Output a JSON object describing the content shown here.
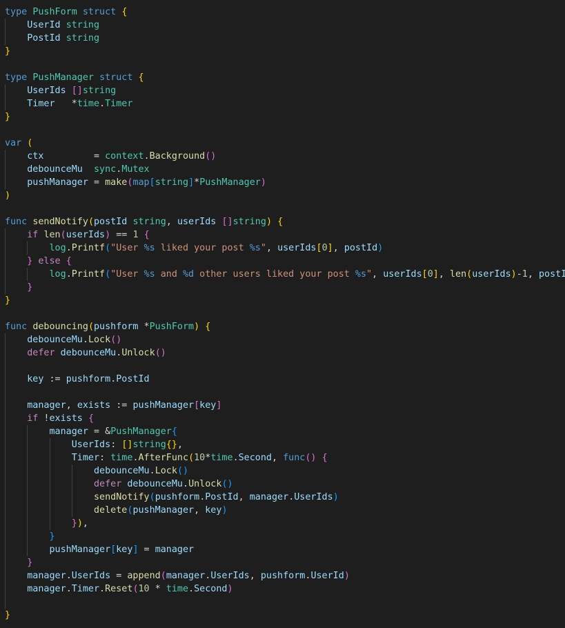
{
  "colors": {
    "background": "#1e1e1e",
    "keyword": "#569cd6",
    "control": "#c586c0",
    "type": "#4ec9b0",
    "variable": "#9cdcfe",
    "function": "#dcdcaa",
    "string": "#ce9178",
    "number": "#b5cea8",
    "bracket_level_1": "#ffd700",
    "bracket_level_2": "#da70d6",
    "bracket_level_3": "#179fff",
    "plain": "#d4d4d4"
  },
  "code": {
    "lines": [
      {
        "indent": 0,
        "tokens": [
          [
            "type",
            "kw"
          ],
          [
            " ",
            "op"
          ],
          [
            "PushForm",
            "type"
          ],
          [
            " ",
            "op"
          ],
          [
            "struct",
            "kw"
          ],
          [
            " ",
            "op"
          ],
          [
            "{",
            "b1"
          ]
        ]
      },
      {
        "indent": 1,
        "tokens": [
          [
            "UserId",
            "var"
          ],
          [
            " ",
            "op"
          ],
          [
            "string",
            "type"
          ]
        ]
      },
      {
        "indent": 1,
        "tokens": [
          [
            "PostId",
            "var"
          ],
          [
            " ",
            "op"
          ],
          [
            "string",
            "type"
          ]
        ]
      },
      {
        "indent": 0,
        "tokens": [
          [
            "}",
            "b1"
          ]
        ]
      },
      {
        "indent": 0,
        "tokens": []
      },
      {
        "indent": 0,
        "tokens": [
          [
            "type",
            "kw"
          ],
          [
            " ",
            "op"
          ],
          [
            "PushManager",
            "type"
          ],
          [
            " ",
            "op"
          ],
          [
            "struct",
            "kw"
          ],
          [
            " ",
            "op"
          ],
          [
            "{",
            "b1"
          ]
        ]
      },
      {
        "indent": 1,
        "tokens": [
          [
            "UserIds",
            "var"
          ],
          [
            " ",
            "op"
          ],
          [
            "[]",
            "b2"
          ],
          [
            "string",
            "type"
          ]
        ]
      },
      {
        "indent": 1,
        "tokens": [
          [
            "Timer",
            "var"
          ],
          [
            "   *",
            "op"
          ],
          [
            "time",
            "type"
          ],
          [
            ".",
            "op"
          ],
          [
            "Timer",
            "type"
          ]
        ]
      },
      {
        "indent": 0,
        "tokens": [
          [
            "}",
            "b1"
          ]
        ]
      },
      {
        "indent": 0,
        "tokens": []
      },
      {
        "indent": 0,
        "tokens": [
          [
            "var",
            "kw"
          ],
          [
            " ",
            "op"
          ],
          [
            "(",
            "b1"
          ]
        ]
      },
      {
        "indent": 1,
        "tokens": [
          [
            "ctx",
            "var"
          ],
          [
            "         = ",
            "op"
          ],
          [
            "context",
            "type"
          ],
          [
            ".",
            "op"
          ],
          [
            "Background",
            "fn"
          ],
          [
            "()",
            "b2"
          ]
        ]
      },
      {
        "indent": 1,
        "tokens": [
          [
            "debounceMu",
            "var"
          ],
          [
            "  ",
            "op"
          ],
          [
            "sync",
            "type"
          ],
          [
            ".",
            "op"
          ],
          [
            "Mutex",
            "type"
          ]
        ]
      },
      {
        "indent": 1,
        "tokens": [
          [
            "pushManager",
            "var"
          ],
          [
            " = ",
            "op"
          ],
          [
            "make",
            "fn"
          ],
          [
            "(",
            "b2"
          ],
          [
            "map",
            "kw"
          ],
          [
            "[",
            "b3"
          ],
          [
            "string",
            "type"
          ],
          [
            "]",
            "b3"
          ],
          [
            "*",
            "op"
          ],
          [
            "PushManager",
            "type"
          ],
          [
            ")",
            "b2"
          ]
        ]
      },
      {
        "indent": 0,
        "tokens": [
          [
            ")",
            "b1"
          ]
        ]
      },
      {
        "indent": 0,
        "tokens": []
      },
      {
        "indent": 0,
        "tokens": [
          [
            "func",
            "kw"
          ],
          [
            " ",
            "op"
          ],
          [
            "sendNotify",
            "fn"
          ],
          [
            "(",
            "b1"
          ],
          [
            "postId",
            "var"
          ],
          [
            " ",
            "op"
          ],
          [
            "string",
            "type"
          ],
          [
            ", ",
            "op"
          ],
          [
            "userIds",
            "var"
          ],
          [
            " ",
            "op"
          ],
          [
            "[]",
            "b2"
          ],
          [
            "string",
            "type"
          ],
          [
            ")",
            "b1"
          ],
          [
            " ",
            "op"
          ],
          [
            "{",
            "b1"
          ]
        ]
      },
      {
        "indent": 1,
        "tokens": [
          [
            "if",
            "ctl"
          ],
          [
            " ",
            "op"
          ],
          [
            "len",
            "fn"
          ],
          [
            "(",
            "b2"
          ],
          [
            "userIds",
            "var"
          ],
          [
            ")",
            "b2"
          ],
          [
            " == ",
            "op"
          ],
          [
            "1",
            "num"
          ],
          [
            " ",
            "op"
          ],
          [
            "{",
            "b2"
          ]
        ]
      },
      {
        "indent": 2,
        "tokens": [
          [
            "log",
            "type"
          ],
          [
            ".",
            "op"
          ],
          [
            "Printf",
            "fn"
          ],
          [
            "(",
            "b3"
          ],
          [
            "\"User ",
            "str"
          ],
          [
            "%s",
            "fmt"
          ],
          [
            " liked your post ",
            "str"
          ],
          [
            "%s",
            "fmt"
          ],
          [
            "\"",
            "str"
          ],
          [
            ", ",
            "op"
          ],
          [
            "userIds",
            "var"
          ],
          [
            "[",
            "b1"
          ],
          [
            "0",
            "num"
          ],
          [
            "]",
            "b1"
          ],
          [
            ", ",
            "op"
          ],
          [
            "postId",
            "var"
          ],
          [
            ")",
            "b3"
          ]
        ]
      },
      {
        "indent": 1,
        "tokens": [
          [
            "}",
            "b2"
          ],
          [
            " ",
            "op"
          ],
          [
            "else",
            "ctl"
          ],
          [
            " ",
            "op"
          ],
          [
            "{",
            "b2"
          ]
        ]
      },
      {
        "indent": 2,
        "tokens": [
          [
            "log",
            "type"
          ],
          [
            ".",
            "op"
          ],
          [
            "Printf",
            "fn"
          ],
          [
            "(",
            "b3"
          ],
          [
            "\"User ",
            "str"
          ],
          [
            "%s",
            "fmt"
          ],
          [
            " and ",
            "str"
          ],
          [
            "%d",
            "fmt"
          ],
          [
            " other users liked your post ",
            "str"
          ],
          [
            "%s",
            "fmt"
          ],
          [
            "\"",
            "str"
          ],
          [
            ", ",
            "op"
          ],
          [
            "userIds",
            "var"
          ],
          [
            "[",
            "b1"
          ],
          [
            "0",
            "num"
          ],
          [
            "]",
            "b1"
          ],
          [
            ", ",
            "op"
          ],
          [
            "len",
            "fn"
          ],
          [
            "(",
            "b1"
          ],
          [
            "userIds",
            "var"
          ],
          [
            ")",
            "b1"
          ],
          [
            "-",
            "op"
          ],
          [
            "1",
            "num"
          ],
          [
            ", ",
            "op"
          ],
          [
            "postId",
            "var"
          ],
          [
            ")",
            "b3"
          ]
        ]
      },
      {
        "indent": 1,
        "tokens": [
          [
            "}",
            "b2"
          ]
        ]
      },
      {
        "indent": 0,
        "tokens": [
          [
            "}",
            "b1"
          ]
        ]
      },
      {
        "indent": 0,
        "tokens": []
      },
      {
        "indent": 0,
        "tokens": [
          [
            "func",
            "kw"
          ],
          [
            " ",
            "op"
          ],
          [
            "debouncing",
            "fn"
          ],
          [
            "(",
            "b1"
          ],
          [
            "pushform",
            "var"
          ],
          [
            " *",
            "op"
          ],
          [
            "PushForm",
            "type"
          ],
          [
            ")",
            "b1"
          ],
          [
            " ",
            "op"
          ],
          [
            "{",
            "b1"
          ]
        ]
      },
      {
        "indent": 1,
        "tokens": [
          [
            "debounceMu",
            "var"
          ],
          [
            ".",
            "op"
          ],
          [
            "Lock",
            "fn"
          ],
          [
            "()",
            "b2"
          ]
        ]
      },
      {
        "indent": 1,
        "tokens": [
          [
            "defer",
            "ctl"
          ],
          [
            " ",
            "op"
          ],
          [
            "debounceMu",
            "var"
          ],
          [
            ".",
            "op"
          ],
          [
            "Unlock",
            "fn"
          ],
          [
            "()",
            "b2"
          ]
        ]
      },
      {
        "indent": 1,
        "tokens": []
      },
      {
        "indent": 1,
        "tokens": [
          [
            "key",
            "var"
          ],
          [
            " := ",
            "op"
          ],
          [
            "pushform",
            "var"
          ],
          [
            ".",
            "op"
          ],
          [
            "PostId",
            "var"
          ]
        ]
      },
      {
        "indent": 1,
        "tokens": []
      },
      {
        "indent": 1,
        "tokens": [
          [
            "manager",
            "var"
          ],
          [
            ", ",
            "op"
          ],
          [
            "exists",
            "var"
          ],
          [
            " := ",
            "op"
          ],
          [
            "pushManager",
            "var"
          ],
          [
            "[",
            "b2"
          ],
          [
            "key",
            "var"
          ],
          [
            "]",
            "b2"
          ]
        ]
      },
      {
        "indent": 1,
        "tokens": [
          [
            "if",
            "ctl"
          ],
          [
            " !",
            "op"
          ],
          [
            "exists",
            "var"
          ],
          [
            " ",
            "op"
          ],
          [
            "{",
            "b2"
          ]
        ]
      },
      {
        "indent": 2,
        "tokens": [
          [
            "manager",
            "var"
          ],
          [
            " = &",
            "op"
          ],
          [
            "PushManager",
            "type"
          ],
          [
            "{",
            "b3"
          ]
        ]
      },
      {
        "indent": 3,
        "tokens": [
          [
            "UserIds",
            "var"
          ],
          [
            ": ",
            "op"
          ],
          [
            "[]",
            "b1"
          ],
          [
            "string",
            "type"
          ],
          [
            "{}",
            "b1"
          ],
          [
            ",",
            "op"
          ]
        ]
      },
      {
        "indent": 3,
        "tokens": [
          [
            "Timer",
            "var"
          ],
          [
            ": ",
            "op"
          ],
          [
            "time",
            "type"
          ],
          [
            ".",
            "op"
          ],
          [
            "AfterFunc",
            "fn"
          ],
          [
            "(",
            "b1"
          ],
          [
            "10",
            "num"
          ],
          [
            "*",
            "op"
          ],
          [
            "time",
            "type"
          ],
          [
            ".",
            "op"
          ],
          [
            "Second",
            "var"
          ],
          [
            ", ",
            "op"
          ],
          [
            "func",
            "kw"
          ],
          [
            "()",
            "b2"
          ],
          [
            " ",
            "op"
          ],
          [
            "{",
            "b2"
          ]
        ]
      },
      {
        "indent": 4,
        "tokens": [
          [
            "debounceMu",
            "var"
          ],
          [
            ".",
            "op"
          ],
          [
            "Lock",
            "fn"
          ],
          [
            "()",
            "b3"
          ]
        ]
      },
      {
        "indent": 4,
        "tokens": [
          [
            "defer",
            "ctl"
          ],
          [
            " ",
            "op"
          ],
          [
            "debounceMu",
            "var"
          ],
          [
            ".",
            "op"
          ],
          [
            "Unlock",
            "fn"
          ],
          [
            "()",
            "b3"
          ]
        ]
      },
      {
        "indent": 4,
        "tokens": [
          [
            "sendNotify",
            "fn"
          ],
          [
            "(",
            "b3"
          ],
          [
            "pushform",
            "var"
          ],
          [
            ".",
            "op"
          ],
          [
            "PostId",
            "var"
          ],
          [
            ", ",
            "op"
          ],
          [
            "manager",
            "var"
          ],
          [
            ".",
            "op"
          ],
          [
            "UserIds",
            "var"
          ],
          [
            ")",
            "b3"
          ]
        ]
      },
      {
        "indent": 4,
        "tokens": [
          [
            "delete",
            "fn"
          ],
          [
            "(",
            "b3"
          ],
          [
            "pushManager",
            "var"
          ],
          [
            ", ",
            "op"
          ],
          [
            "key",
            "var"
          ],
          [
            ")",
            "b3"
          ]
        ]
      },
      {
        "indent": 3,
        "tokens": [
          [
            "}",
            "b2"
          ],
          [
            ")",
            "b1"
          ],
          [
            ",",
            "op"
          ]
        ]
      },
      {
        "indent": 2,
        "tokens": [
          [
            "}",
            "b3"
          ]
        ]
      },
      {
        "indent": 2,
        "tokens": [
          [
            "pushManager",
            "var"
          ],
          [
            "[",
            "b3"
          ],
          [
            "key",
            "var"
          ],
          [
            "]",
            "b3"
          ],
          [
            " = ",
            "op"
          ],
          [
            "manager",
            "var"
          ]
        ]
      },
      {
        "indent": 1,
        "tokens": [
          [
            "}",
            "b2"
          ]
        ]
      },
      {
        "indent": 1,
        "tokens": [
          [
            "manager",
            "var"
          ],
          [
            ".",
            "op"
          ],
          [
            "UserIds",
            "var"
          ],
          [
            " = ",
            "op"
          ],
          [
            "append",
            "fn"
          ],
          [
            "(",
            "b2"
          ],
          [
            "manager",
            "var"
          ],
          [
            ".",
            "op"
          ],
          [
            "UserIds",
            "var"
          ],
          [
            ", ",
            "op"
          ],
          [
            "pushform",
            "var"
          ],
          [
            ".",
            "op"
          ],
          [
            "UserId",
            "var"
          ],
          [
            ")",
            "b2"
          ]
        ]
      },
      {
        "indent": 1,
        "tokens": [
          [
            "manager",
            "var"
          ],
          [
            ".",
            "op"
          ],
          [
            "Timer",
            "var"
          ],
          [
            ".",
            "op"
          ],
          [
            "Reset",
            "fn"
          ],
          [
            "(",
            "b2"
          ],
          [
            "10",
            "num"
          ],
          [
            " * ",
            "op"
          ],
          [
            "time",
            "type"
          ],
          [
            ".",
            "op"
          ],
          [
            "Second",
            "var"
          ],
          [
            ")",
            "b2"
          ]
        ]
      },
      {
        "indent": 1,
        "tokens": []
      },
      {
        "indent": 0,
        "tokens": [
          [
            "}",
            "b1"
          ]
        ]
      }
    ]
  }
}
